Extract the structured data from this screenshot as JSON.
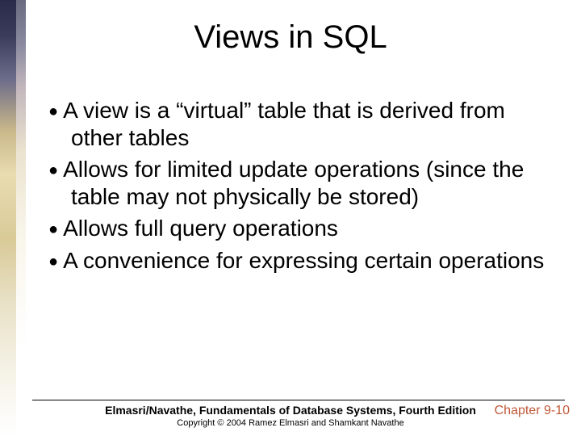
{
  "title": "Views in SQL",
  "bullets": [
    "A view is a “virtual” table that is derived from other tables",
    "Allows for limited update operations (since the table may not physically be stored)",
    "Allows full query operations",
    "A convenience for expressing certain operations"
  ],
  "footer": {
    "main": "Elmasri/Navathe, Fundamentals of Database Systems, Fourth Edition",
    "copyright": "Copyright © 2004 Ramez Elmasri and Shamkant Navathe"
  },
  "chapter": "Chapter 9-10"
}
